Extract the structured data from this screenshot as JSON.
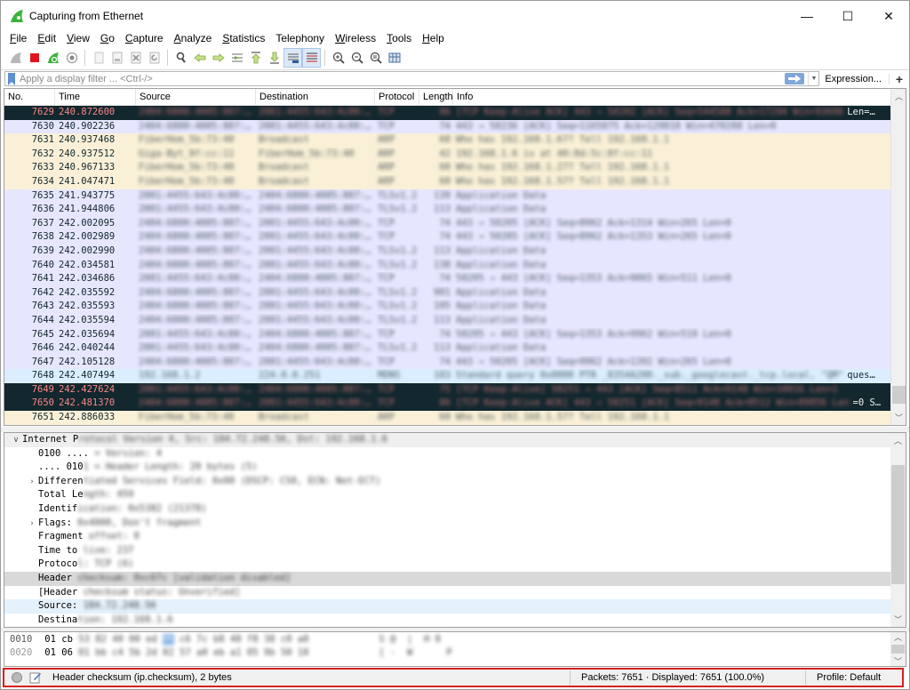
{
  "window": {
    "title": "Capturing from Ethernet",
    "controls": {
      "minimize": "—",
      "maximize": "☐",
      "close": "✕"
    }
  },
  "menu": [
    {
      "label": "File",
      "accel": "F",
      "rest": "ile"
    },
    {
      "label": "Edit",
      "accel": "E",
      "rest": "dit"
    },
    {
      "label": "View",
      "accel": "V",
      "rest": "iew"
    },
    {
      "label": "Go",
      "accel": "G",
      "rest": "o"
    },
    {
      "label": "Capture",
      "accel": "C",
      "rest": "apture"
    },
    {
      "label": "Analyze",
      "accel": "A",
      "rest": "nalyze"
    },
    {
      "label": "Statistics",
      "accel": "S",
      "rest": "tatistics"
    },
    {
      "label": "Telephony",
      "accel": "",
      "rest": "Telephony"
    },
    {
      "label": "Wireless",
      "accel": "W",
      "rest": "ireless"
    },
    {
      "label": "Tools",
      "accel": "T",
      "rest": "ools"
    },
    {
      "label": "Help",
      "accel": "H",
      "rest": "elp"
    }
  ],
  "toolbar": {
    "icons": [
      "start-capture-icon",
      "stop-capture-icon",
      "restart-capture-icon",
      "capture-options-icon",
      "open-file-icon",
      "save-file-icon",
      "close-file-icon",
      "reload-file-icon",
      "find-packet-icon",
      "go-back-icon",
      "go-forward-icon",
      "go-to-packet-icon",
      "go-first-icon",
      "go-last-icon",
      "auto-scroll-icon",
      "colorize-icon",
      "zoom-in-icon",
      "zoom-out-icon",
      "zoom-normal-icon",
      "resize-columns-icon"
    ]
  },
  "filter": {
    "placeholder": "Apply a display filter ... <Ctrl-/>",
    "value": "",
    "expression_label": "Expression...",
    "add_label": "+"
  },
  "packet_list": {
    "columns": [
      "No.",
      "Time",
      "Source",
      "Destination",
      "Protocol",
      "Length",
      "Info"
    ],
    "rows": [
      {
        "no": "7629",
        "time": "240.872600",
        "src": "2404:6800:4005:807:…",
        "dst": "2001:4455:643:4c00:…",
        "proto": "TCP",
        "len": "86",
        "info": "[TCP Keep-Alive ACK] 443 → 50202 [ACK] Seq=544588 Ack=17294 Win=93696",
        "info_tail": "Len=…",
        "style": "bad"
      },
      {
        "no": "7630",
        "time": "240.902236",
        "src": "2404:6800:4005:807:…",
        "dst": "2001:4455:643:4c00:…",
        "proto": "TCP",
        "len": "74",
        "info": "443 → 50236 [ACK] Seq=1165075 Ack=129818 Win=470288 Len=0",
        "info_tail": "",
        "style": "tcp"
      },
      {
        "no": "7631",
        "time": "240.937468",
        "src": "FiberHom_5b:73:40",
        "dst": "Broadcast",
        "proto": "ARP",
        "len": "60",
        "info": "Who has 192.168.1.67? Tell 192.168.1.1",
        "info_tail": "",
        "style": "arp"
      },
      {
        "no": "7632",
        "time": "240.937512",
        "src": "Giga-Byt_8f:cc:11",
        "dst": "FiberHom_5b:73:40",
        "proto": "ARP",
        "len": "42",
        "info": "192.168.1.6 is at 40:8d:5c:8f:cc:11",
        "info_tail": "",
        "style": "arp"
      },
      {
        "no": "7633",
        "time": "240.967133",
        "src": "FiberHom_5b:73:40",
        "dst": "Broadcast",
        "proto": "ARP",
        "len": "60",
        "info": "Who has 192.168.1.27? Tell 192.168.1.1",
        "info_tail": "",
        "style": "arp"
      },
      {
        "no": "7634",
        "time": "241.047471",
        "src": "FiberHom_5b:73:40",
        "dst": "Broadcast",
        "proto": "ARP",
        "len": "60",
        "info": "Who has 192.168.1.57? Tell 192.168.1.1",
        "info_tail": "",
        "style": "arp"
      },
      {
        "no": "7635",
        "time": "241.943775",
        "src": "2001:4455:643:4c00:…",
        "dst": "2404:6800:4005:807:…",
        "proto": "TLSv1.2",
        "len": "139",
        "info": "Application Data",
        "info_tail": "",
        "style": "tcp"
      },
      {
        "no": "7636",
        "time": "241.944806",
        "src": "2001:4455:643:4c00:…",
        "dst": "2404:6800:4005:807:…",
        "proto": "TLSv1.2",
        "len": "113",
        "info": "Application Data",
        "info_tail": "",
        "style": "tcp"
      },
      {
        "no": "7637",
        "time": "242.002095",
        "src": "2404:6800:4005:807:…",
        "dst": "2001:4455:643:4c00:…",
        "proto": "TCP",
        "len": "74",
        "info": "443 → 50205 [ACK] Seq=8962 Ack=1314 Win=265 Len=0",
        "info_tail": "",
        "style": "tcp"
      },
      {
        "no": "7638",
        "time": "242.002989",
        "src": "2404:6800:4005:807:…",
        "dst": "2001:4455:643:4c00:…",
        "proto": "TCP",
        "len": "74",
        "info": "443 → 50205 [ACK] Seq=8962 Ack=1353 Win=265 Len=0",
        "info_tail": "",
        "style": "tcp"
      },
      {
        "no": "7639",
        "time": "242.002990",
        "src": "2404:6800:4005:807:…",
        "dst": "2001:4455:643:4c00:…",
        "proto": "TLSv1.2",
        "len": "113",
        "info": "Application Data",
        "info_tail": "",
        "style": "tcp"
      },
      {
        "no": "7640",
        "time": "242.034581",
        "src": "2404:6800:4005:807:…",
        "dst": "2001:4455:643:4c00:…",
        "proto": "TLSv1.2",
        "len": "138",
        "info": "Application Data",
        "info_tail": "",
        "style": "tcp"
      },
      {
        "no": "7641",
        "time": "242.034686",
        "src": "2001:4455:643:4c00:…",
        "dst": "2404:6800:4005:807:…",
        "proto": "TCP",
        "len": "74",
        "info": "50205 → 443 [ACK] Seq=1353 Ack=9065 Win=511 Len=0",
        "info_tail": "",
        "style": "tcp"
      },
      {
        "no": "7642",
        "time": "242.035592",
        "src": "2404:6800:4005:807:…",
        "dst": "2001:4455:643:4c00:…",
        "proto": "TLSv1.2",
        "len": "901",
        "info": "Application Data",
        "info_tail": "",
        "style": "tcp"
      },
      {
        "no": "7643",
        "time": "242.035593",
        "src": "2404:6800:4005:807:…",
        "dst": "2001:4455:643:4c00:…",
        "proto": "TLSv1.2",
        "len": "105",
        "info": "Application Data",
        "info_tail": "",
        "style": "tcp"
      },
      {
        "no": "7644",
        "time": "242.035594",
        "src": "2404:6800:4005:807:…",
        "dst": "2001:4455:643:4c00:…",
        "proto": "TLSv1.2",
        "len": "113",
        "info": "Application Data",
        "info_tail": "",
        "style": "tcp"
      },
      {
        "no": "7645",
        "time": "242.035694",
        "src": "2001:4455:643:4c00:…",
        "dst": "2404:6800:4005:807:…",
        "proto": "TCP",
        "len": "74",
        "info": "50205 → 443 [ACK] Seq=1353 Ack=9962 Win=519 Len=0",
        "info_tail": "",
        "style": "tcp"
      },
      {
        "no": "7646",
        "time": "242.040244",
        "src": "2001:4455:643:4c00:…",
        "dst": "2404:6800:4005:807:…",
        "proto": "TLSv1.2",
        "len": "113",
        "info": "Application Data",
        "info_tail": "",
        "style": "tcp"
      },
      {
        "no": "7647",
        "time": "242.105128",
        "src": "2404:6800:4005:807:…",
        "dst": "2001:4455:643:4c00:…",
        "proto": "TCP",
        "len": "74",
        "info": "443 → 50205 [ACK] Seq=9962 Ack=1392 Win=265 Len=0",
        "info_tail": "",
        "style": "tcp"
      },
      {
        "no": "7648",
        "time": "242.407494",
        "src": "192.168.1.2",
        "dst": "224.0.0.251",
        "proto": "MDNS",
        "len": "103",
        "info": "Standard query 0x0000 PTR _8354A200._sub._googlecast._tcp.local, \"QM\"",
        "info_tail": "ques…",
        "style": "mdns"
      },
      {
        "no": "7649",
        "time": "242.427624",
        "src": "2001:4455:643:4c00:…",
        "dst": "2404:6800:4005:807:…",
        "proto": "TCP",
        "len": "75",
        "info": "[TCP Keep-Alive] 50251 → 443 [ACK] Seq=8511 Ack=9148 Win=10016 Len=1",
        "info_tail": "",
        "style": "bad"
      },
      {
        "no": "7650",
        "time": "242.481370",
        "src": "2404:6800:4005:807:…",
        "dst": "2001:4455:643:4c00:…",
        "proto": "TCP",
        "len": "86",
        "info": "[TCP Keep-Alive ACK] 443 → 50251 [ACK] Seq=9148 Ack=8512 Win=89856 Len",
        "info_tail": "=0 S…",
        "style": "bad"
      },
      {
        "no": "7651",
        "time": "242.886033",
        "src": "FiberHom_5b:73:40",
        "dst": "Broadcast",
        "proto": "ARP",
        "len": "60",
        "info": "Who has 192.168.1.57? Tell 192.168.1.1",
        "info_tail": "",
        "style": "arp"
      }
    ]
  },
  "details": {
    "rows": [
      {
        "expander": "∨",
        "indent": 0,
        "visible": "Internet P",
        "blurred": "rotocol Version 4, Src: 184.72.248.56, Dst: 192.168.1.6",
        "style": "top"
      },
      {
        "expander": "",
        "indent": 1,
        "visible": "0100 ....",
        "blurred": " = Version: 4",
        "style": ""
      },
      {
        "expander": "",
        "indent": 1,
        "visible": ".... 010",
        "blurred": "1 = Header Length: 20 bytes (5)",
        "style": ""
      },
      {
        "expander": "›",
        "indent": 1,
        "visible": "Differen",
        "blurred": "tiated Services Field: 0x00 (DSCP: CS0, ECN: Not-ECT)",
        "style": ""
      },
      {
        "expander": "",
        "indent": 1,
        "visible": "Total Le",
        "blurred": "ngth: 459",
        "style": ""
      },
      {
        "expander": "",
        "indent": 1,
        "visible": "Identif",
        "blurred": "ication: 0x5382 (21378)",
        "style": ""
      },
      {
        "expander": "›",
        "indent": 1,
        "visible": "Flags: ",
        "blurred": "0x4000, Don't fragment",
        "style": ""
      },
      {
        "expander": "",
        "indent": 1,
        "visible": "Fragment",
        "blurred": " offset: 0",
        "style": ""
      },
      {
        "expander": "",
        "indent": 1,
        "visible": "Time to ",
        "blurred": "live: 237",
        "style": ""
      },
      {
        "expander": "",
        "indent": 1,
        "visible": "Protoco",
        "blurred": "l: TCP (6)",
        "style": ""
      },
      {
        "expander": "",
        "indent": 1,
        "visible": "Header ",
        "blurred": "checksum: 0xc67c [validation disabled]",
        "style": "sel-gray"
      },
      {
        "expander": "",
        "indent": 1,
        "visible": "[Header ",
        "blurred": "checksum status: Unverified]",
        "style": ""
      },
      {
        "expander": "",
        "indent": 1,
        "visible": "Source: ",
        "blurred": "184.72.248.56",
        "style": "sel-blue"
      },
      {
        "expander": "",
        "indent": 1,
        "visible": "Destina",
        "blurred": "tion: 192.168.1.6",
        "style": ""
      }
    ]
  },
  "bytes": {
    "rows": [
      {
        "offset": "0010",
        "visible": "01 cb ",
        "before": "53 82 40 00 ed ",
        "highlight": "06",
        "after": " c6 7c b8 48 f8 38 c0 a8",
        "ascii": "   S @  |  H 8  ",
        "dim": false
      },
      {
        "offset": "0020",
        "visible": "01 06 ",
        "before": "01 bb c4 5b 2d 02 ",
        "highlight": "",
        "after": "57 a0 eb a1 05 9b 50 18",
        "ascii": "   [ -  W      P ",
        "dim": true
      }
    ]
  },
  "status": {
    "field_text": "Header checksum (ip.checksum), 2 bytes",
    "packets_text": "Packets: 7651 · Displayed: 7651 (100.0%)",
    "profile_text": "Profile: Default",
    "highlight_color": "#d62020"
  },
  "colors": {
    "tcp_row_bg": "#e7e6ff",
    "arp_row_bg": "#faf0d7",
    "mdns_row_bg": "#daeeff",
    "bad_row_bg": "#12272e",
    "bad_row_fg": "#f78787",
    "wireshark_green": "#3bb33b"
  }
}
